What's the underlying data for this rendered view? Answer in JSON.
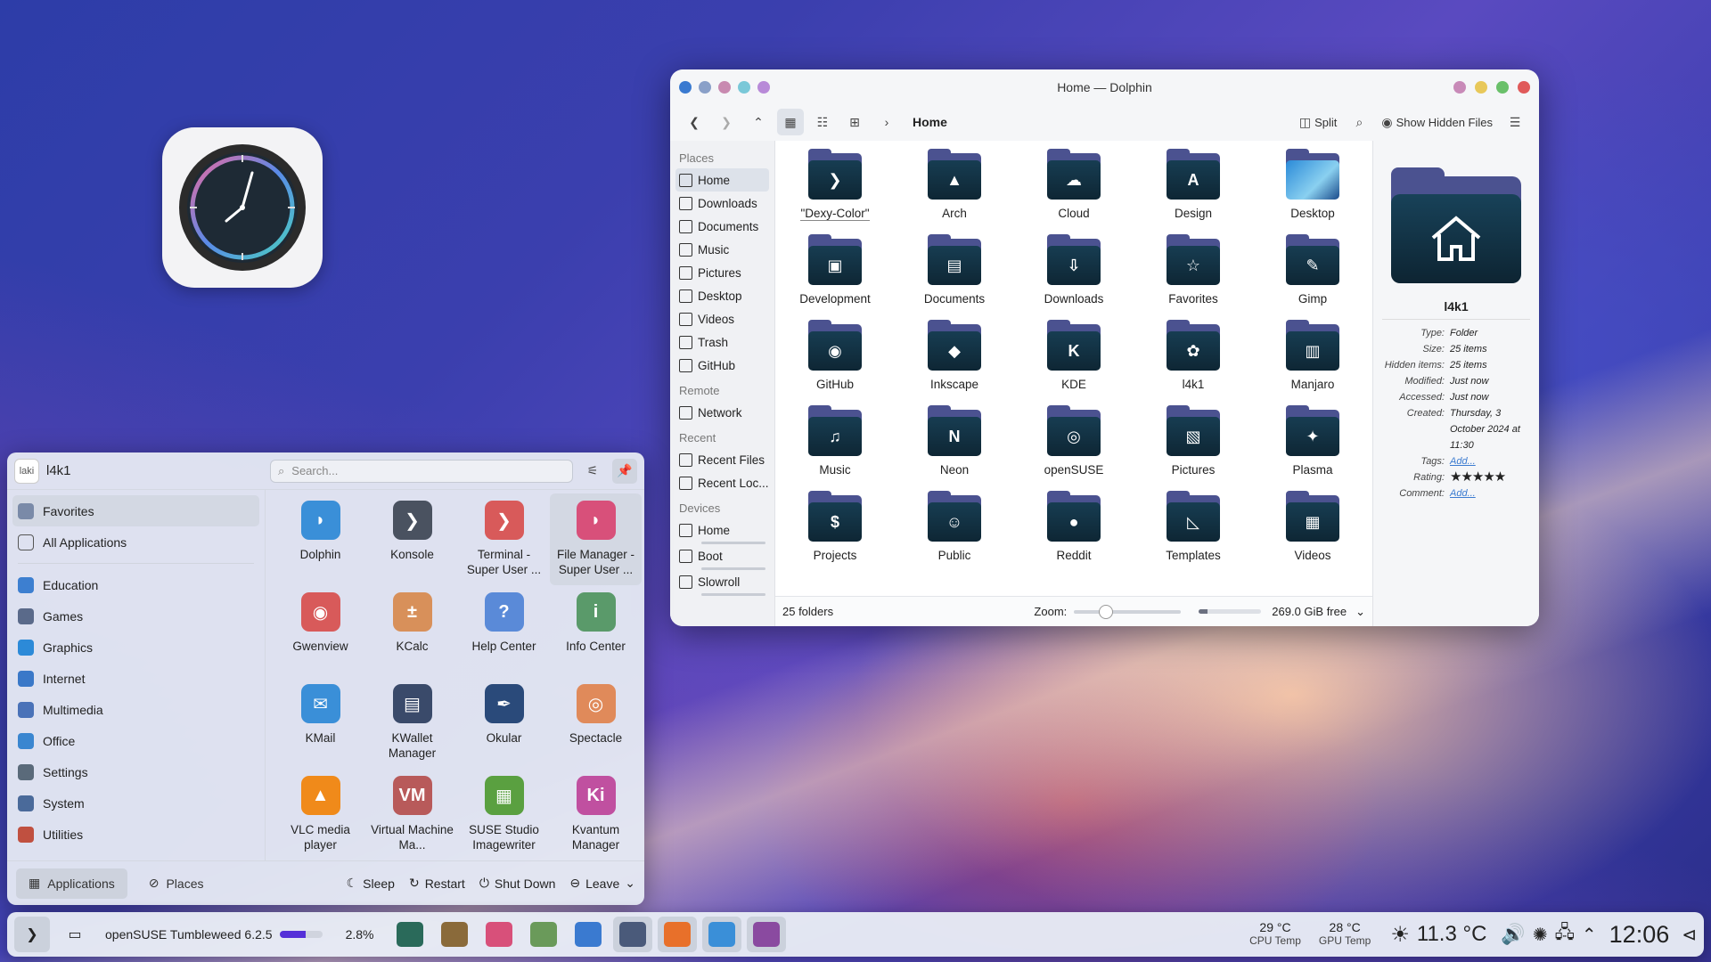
{
  "dolphin": {
    "title": "Home — Dolphin",
    "breadcrumb": "Home",
    "split_label": "Split",
    "hidden_files_label": "Show Hidden Files",
    "places": {
      "headers": {
        "places": "Places",
        "remote": "Remote",
        "recent": "Recent",
        "devices": "Devices"
      },
      "items": [
        "Home",
        "Downloads",
        "Documents",
        "Music",
        "Pictures",
        "Desktop",
        "Videos",
        "Trash",
        "GitHub"
      ],
      "remote": [
        "Network"
      ],
      "recent": [
        "Recent Files",
        "Recent Loc..."
      ],
      "devices": [
        "Home",
        "Boot",
        "Slowroll"
      ]
    },
    "folders": [
      {
        "name": "\"Dexy-Color\"",
        "glyph": "❯"
      },
      {
        "name": "Arch",
        "glyph": "▲"
      },
      {
        "name": "Cloud",
        "glyph": "☁"
      },
      {
        "name": "Design",
        "glyph": "A"
      },
      {
        "name": "Desktop",
        "glyph": ""
      },
      {
        "name": "Development",
        "glyph": "▣"
      },
      {
        "name": "Documents",
        "glyph": "▤"
      },
      {
        "name": "Downloads",
        "glyph": "⇩"
      },
      {
        "name": "Favorites",
        "glyph": "☆"
      },
      {
        "name": "Gimp",
        "glyph": "✎"
      },
      {
        "name": "GitHub",
        "glyph": "◉"
      },
      {
        "name": "Inkscape",
        "glyph": "◆"
      },
      {
        "name": "KDE",
        "glyph": "K"
      },
      {
        "name": "l4k1",
        "glyph": "✿"
      },
      {
        "name": "Manjaro",
        "glyph": "▥"
      },
      {
        "name": "Music",
        "glyph": "♫"
      },
      {
        "name": "Neon",
        "glyph": "N"
      },
      {
        "name": "openSUSE",
        "glyph": "◎"
      },
      {
        "name": "Pictures",
        "glyph": "▧"
      },
      {
        "name": "Plasma",
        "glyph": "✦"
      },
      {
        "name": "Projects",
        "glyph": "$"
      },
      {
        "name": "Public",
        "glyph": "☺"
      },
      {
        "name": "Reddit",
        "glyph": "●"
      },
      {
        "name": "Templates",
        "glyph": "◺"
      },
      {
        "name": "Videos",
        "glyph": "▦"
      }
    ],
    "status": {
      "count": "25 folders",
      "zoom_label": "Zoom:",
      "free": "269.0 GiB free"
    },
    "info": {
      "name": "l4k1",
      "rows": [
        {
          "k": "Type:",
          "v": "Folder"
        },
        {
          "k": "Size:",
          "v": "25 items"
        },
        {
          "k": "Hidden items:",
          "v": "25 items"
        },
        {
          "k": "Modified:",
          "v": "Just now"
        },
        {
          "k": "Accessed:",
          "v": "Just now"
        },
        {
          "k": "Created:",
          "v": "Thursday, 3 October 2024 at 11:30"
        }
      ],
      "tags_k": "Tags:",
      "tags_v": "Add...",
      "rating_k": "Rating:",
      "rating_v": "★★★★★",
      "comment_k": "Comment:",
      "comment_v": "Add..."
    }
  },
  "launcher": {
    "avatar_text": "laki",
    "user": "l4k1",
    "search_placeholder": "Search...",
    "categories_top": [
      "Favorites",
      "All Applications"
    ],
    "categories": [
      {
        "name": "Education",
        "color": "#3d7fd0"
      },
      {
        "name": "Games",
        "color": "#5a6a8a"
      },
      {
        "name": "Graphics",
        "color": "#2c8ad8"
      },
      {
        "name": "Internet",
        "color": "#3a78c8"
      },
      {
        "name": "Multimedia",
        "color": "#4a72b8"
      },
      {
        "name": "Office",
        "color": "#3a86d0"
      },
      {
        "name": "Settings",
        "color": "#5a6a7a"
      },
      {
        "name": "System",
        "color": "#4a6a9a"
      },
      {
        "name": "Utilities",
        "color": "#c05040"
      }
    ],
    "apps": [
      {
        "name": "Dolphin",
        "color": "#3a8fd8",
        "glyph": "◗"
      },
      {
        "name": "Konsole",
        "color": "#4a5260",
        "glyph": "❯"
      },
      {
        "name": "Terminal - Super User ...",
        "color": "#d85a5a",
        "glyph": "❯"
      },
      {
        "name": "File Manager - Super User ...",
        "color": "#d8507a",
        "glyph": "◗"
      },
      {
        "name": "Gwenview",
        "color": "#d85a5a",
        "glyph": "◉"
      },
      {
        "name": "KCalc",
        "color": "#d8905a",
        "glyph": "±"
      },
      {
        "name": "Help Center",
        "color": "#5a8ad8",
        "glyph": "?"
      },
      {
        "name": "Info Center",
        "color": "#5a9a6a",
        "glyph": "i"
      },
      {
        "name": "KMail",
        "color": "#3a8fd8",
        "glyph": "✉"
      },
      {
        "name": "KWallet Manager",
        "color": "#3a4a6a",
        "glyph": "▤"
      },
      {
        "name": "Okular",
        "color": "#2a4a7a",
        "glyph": "✒"
      },
      {
        "name": "Spectacle",
        "color": "#e08a5a",
        "glyph": "◎"
      },
      {
        "name": "VLC media player",
        "color": "#f08a1a",
        "glyph": "▲"
      },
      {
        "name": "Virtual Machine Ma...",
        "color": "#b85a5a",
        "glyph": "VM"
      },
      {
        "name": "SUSE Studio Imagewriter",
        "color": "#5aa040",
        "glyph": "▦"
      },
      {
        "name": "Kvantum Manager",
        "color": "#c050a0",
        "glyph": "Ki"
      }
    ],
    "footer": {
      "applications": "Applications",
      "places": "Places",
      "sleep": "Sleep",
      "restart": "Restart",
      "shutdown": "Shut Down",
      "leave": "Leave"
    }
  },
  "panel": {
    "os_label": "openSUSE Tumbleweed 6.2.5",
    "cpu_usage": "2.8%",
    "progress_fraction": 0.62,
    "cpu_temp": "29 °C",
    "cpu_temp_label": "CPU Temp",
    "gpu_temp": "28 °C",
    "gpu_temp_label": "GPU Temp",
    "weather": "11.3 °C",
    "time": "12:06",
    "tasks": [
      {
        "name": "system-monitor",
        "color": "#2a6a5a"
      },
      {
        "name": "gimp",
        "color": "#8a6a3a"
      },
      {
        "name": "color-picker",
        "color": "#d8507a"
      },
      {
        "name": "image-editor",
        "color": "#6a9a5a"
      },
      {
        "name": "shop",
        "color": "#3a7ad0"
      },
      {
        "name": "settings",
        "color": "#4a5a7a"
      },
      {
        "name": "firefox",
        "color": "#e8702a"
      },
      {
        "name": "dolphin",
        "color": "#3a8fd8"
      },
      {
        "name": "kvantum",
        "color": "#8a4aa0"
      }
    ]
  },
  "colors": {
    "accent": "#5530d8",
    "folder_front": "#173d52",
    "folder_back": "#4b5290"
  }
}
